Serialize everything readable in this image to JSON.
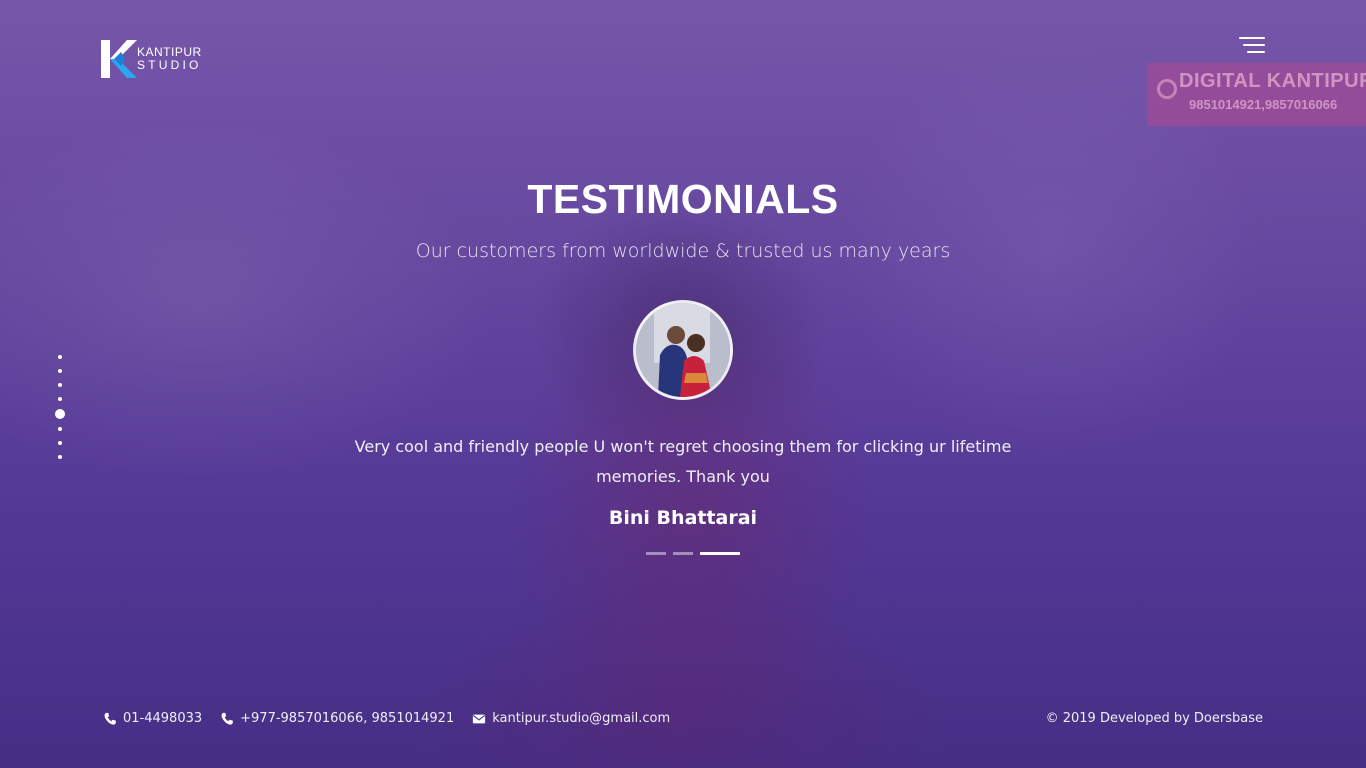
{
  "brand": {
    "line1": "KANTIPUR",
    "line2": "STUDIO"
  },
  "watermark": {
    "title": "DIGITAL KANTIPUR",
    "phone": "9851014921,9857016066"
  },
  "header": {
    "menu_icon": "hamburger-menu-icon"
  },
  "section_nav": {
    "count": 8,
    "active_index": 4
  },
  "testimonials": {
    "title": "TESTIMONIALS",
    "subtitle": "Our customers from worldwide & trusted us many years",
    "quote": "Very cool and friendly people U won't regret choosing them for clicking ur lifetime memories. Thank you",
    "author": "Bini Bhattarai",
    "slides": 3,
    "active_slide": 2
  },
  "footer": {
    "phone": "01-4498033",
    "mobile": "+977-9857016066, 9851014921",
    "email": "kantipur.studio@gmail.com",
    "copyright": "© 2019 Developed by Doersbase"
  },
  "colors": {
    "overlay": "#5a3f9c",
    "logo_blue": "#29a8f0",
    "logo_white": "#ffffff"
  }
}
